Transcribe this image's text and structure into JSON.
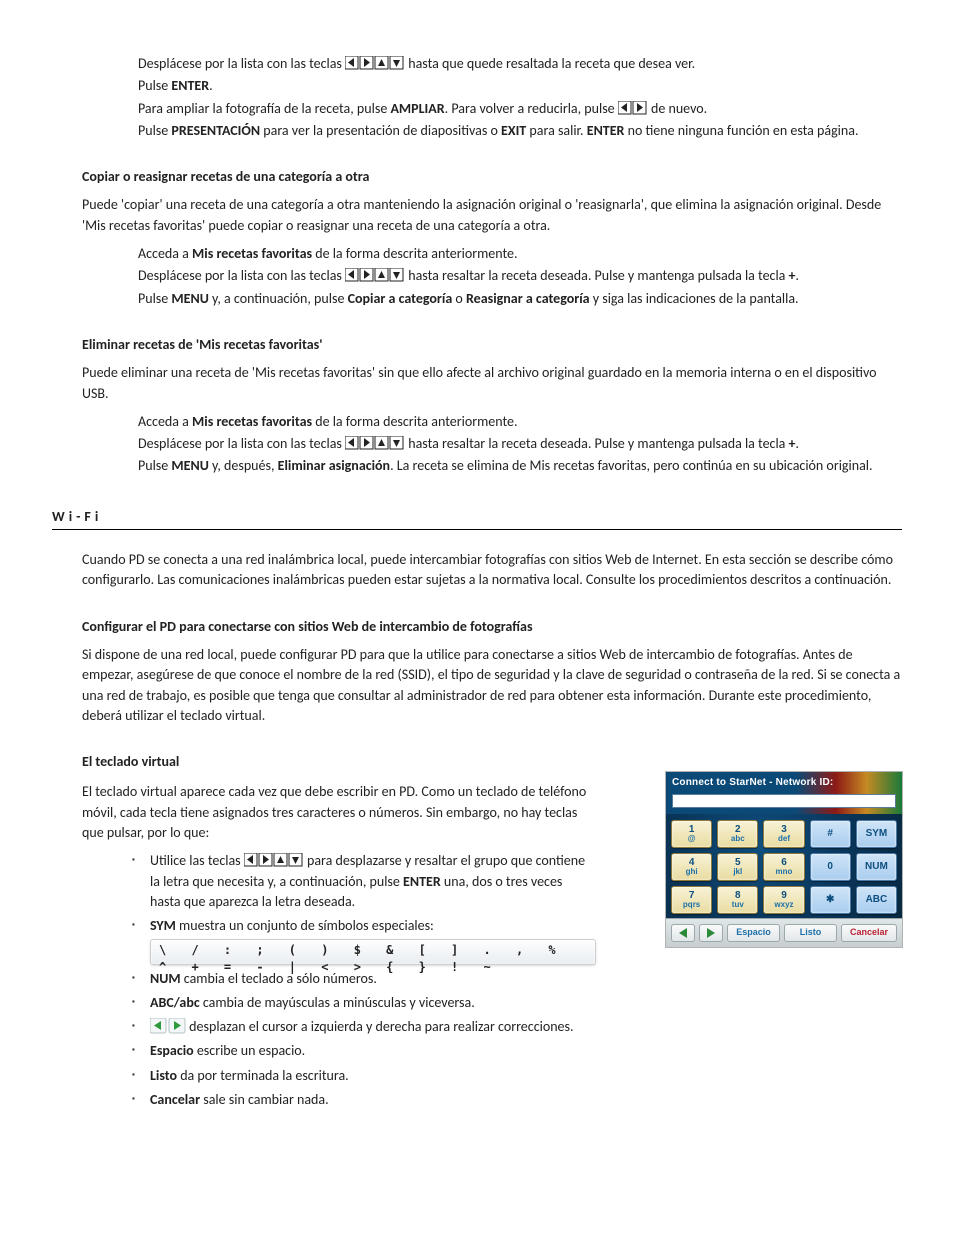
{
  "sec1": {
    "line1_a": "Desplácese por la lista con las teclas ",
    "line1_b": " hasta que quede resaltada la receta que desea ver.",
    "line2_a": "Pulse ",
    "line2_b": "ENTER",
    "line2_c": ".",
    "line3_a": "Para ampliar la fotografía de la receta, pulse ",
    "line3_b": "AMPLIAR",
    "line3_c": ". Para volver a reducirla, pulse ",
    "line3_d": " de nuevo.",
    "line4_a": "Pulse ",
    "line4_b": "PRESENTACIÓN",
    "line4_c": " para ver la presentación de diapositivas o ",
    "line4_d": "EXIT",
    "line4_e": " para salir. ",
    "line4_f": "ENTER",
    "line4_g": " no tiene ninguna función en esta página."
  },
  "sec_copy": {
    "heading": "Copiar o reasignar recetas de una categoría a otra",
    "l1": "Puede 'copiar' una receta de una categoría a otra manteniendo la asignación original o 'reasignarla', que elimina la asignación original. Desde 'Mis recetas favoritas' puede copiar o reasignar una receta de una categoría a otra.",
    "l2_a": "Acceda a ",
    "l2_b": "Mis recetas favoritas",
    "l2_c": " de la forma descrita anteriormente.",
    "l3_a": "Desplácese por la lista con las teclas ",
    "l3_b": " hasta resaltar la receta deseada. Pulse y mantenga pulsada la tecla ",
    "l3_plus": "+",
    "l3_c": ".",
    "l4_a": "Pulse ",
    "l4_b": "MENU",
    "l4_c": " y, a continuación, pulse ",
    "l4_d": "Copiar a categoría",
    "l4_e": " o ",
    "l4_f": "Reasignar a categoría",
    "l4_g": " y siga las indicaciones de la pantalla."
  },
  "sec_del": {
    "heading": "Eliminar recetas de 'Mis recetas favoritas'",
    "l1": "Puede eliminar una receta de 'Mis recetas favoritas' sin que ello afecte al archivo original guardado en la memoria interna o en el dispositivo USB.",
    "l2_a": "Acceda a ",
    "l2_b": "Mis recetas favoritas",
    "l2_c": " de la forma descrita anteriormente.",
    "l3_a": "Desplácese por la lista con las teclas ",
    "l3_b": " hasta resaltar la receta deseada. Pulse y mantenga pulsada la tecla ",
    "l3_plus": "+",
    "l3_c": ".",
    "l4_a": "Pulse ",
    "l4_b": "MENU",
    "l4_c": " y, después, ",
    "l4_d": "Eliminar asignación",
    "l4_e": ". La receta se elimina de Mis recetas favoritas, pero continúa en su ubicación original."
  },
  "wifi": {
    "header": "Wi-Fi",
    "intro": "Cuando PD se conecta a una red inalámbrica local, puede intercambiar fotografías con sitios Web de Internet. En esta sección se describe cómo configurarlo. Las comunicaciones inalámbricas pueden estar sujetas a la normativa local. Consulte los procedimientos descritos a continuación.",
    "cfg_heading": "Configurar el PD para conectarse con sitios Web de intercambio de fotografías",
    "cfg_p1": "Si dispone de una red local, puede configurar PD para que la utilice para conectarse a sitios Web de intercambio de fotografías. Antes de empezar, asegúrese de que conoce el nombre de la red (SSID), el tipo de seguridad y la clave de seguridad o contraseña de la red. Si se conecta a una red de trabajo, es posible que tenga que consultar al administrador de red para obtener esta información. Durante este procedimiento, deberá utilizar el teclado virtual.",
    "kb_heading": "El teclado virtual",
    "kb_p1": "El teclado virtual aparece cada vez que debe escribir en PD. Como un teclado de teléfono móvil, cada tecla tiene asignados tres caracteres o números. Sin embargo, no hay teclas que pulsar, por lo que:",
    "li1_a": "Utilice las teclas ",
    "li1_b": " para desplazarse y resaltar el grupo que contiene la letra que necesita y, a continuación, pulse ",
    "li1_c": "ENTER",
    "li1_d": " una, dos o tres veces hasta que aparezca la letra deseada.",
    "li2_a": "SYM",
    "li2_b": " muestra un conjunto de símbolos especiales:",
    "symrow": "\\ / : ; ( ) $ & [ ] . , % ^ + = - | < > { } ! ~",
    "li3_a": "NUM",
    "li3_b": " cambia el teclado a sólo números.",
    "li4_a": "ABC/abc",
    "li4_b": " cambia de mayúsculas a minúsculas y viceversa.",
    "li5_a": " desplazan el cursor a izquierda y derecha para realizar correcciones.",
    "li6_a": "Espacio",
    "li6_b": " escribe un espacio.",
    "li7_a": "Listo",
    "li7_b": " da por terminada la escritura.",
    "li8_a": "Cancelar",
    "li8_b": " sale sin cambiar nada."
  },
  "vkb": {
    "title": "Connect to StarNet - Network ID:",
    "keys": [
      {
        "t": "1",
        "b": "@"
      },
      {
        "t": "2",
        "b": "abc"
      },
      {
        "t": "3",
        "b": "def"
      },
      {
        "t": "#",
        "b": ""
      },
      {
        "t": "SYM",
        "b": ""
      },
      {
        "t": "4",
        "b": "ghi"
      },
      {
        "t": "5",
        "b": "jkl"
      },
      {
        "t": "6",
        "b": "mno"
      },
      {
        "t": "0",
        "b": ""
      },
      {
        "t": "NUM",
        "b": ""
      },
      {
        "t": "7",
        "b": "pqrs"
      },
      {
        "t": "8",
        "b": "tuv"
      },
      {
        "t": "9",
        "b": "wxyz"
      },
      {
        "t": "✱",
        "b": ""
      },
      {
        "t": "ABC",
        "b": ""
      }
    ],
    "foot": {
      "space": "Espacio",
      "done": "Listo",
      "cancel": "Cancelar"
    }
  }
}
